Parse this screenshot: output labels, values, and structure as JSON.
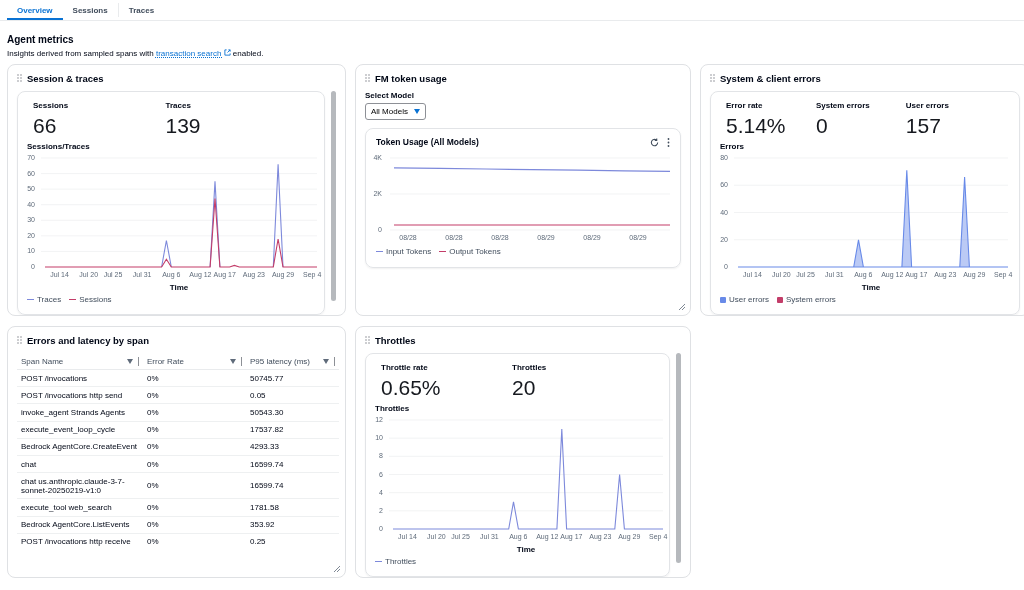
{
  "tabs": [
    {
      "label": "Overview",
      "selected": true
    },
    {
      "label": "Sessions",
      "selected": false
    },
    {
      "label": "Traces",
      "selected": false
    }
  ],
  "heading": "Agent metrics",
  "description": {
    "before": "Insights derived from sampled spans with",
    "link": "transaction search",
    "after": "enabled."
  },
  "panels": [
    {
      "kind": "metrics",
      "title": "Session & traces",
      "scrollable": true,
      "stats": [
        {
          "label": "Sessions",
          "value": "66"
        },
        {
          "label": "Traces",
          "value": "139"
        }
      ],
      "chart_data": {
        "type": "line",
        "ylabel": "Sessions/Traces",
        "xlabel": "Time",
        "ylim": [
          0,
          70
        ],
        "yticks": [
          0,
          10,
          20,
          30,
          40,
          50,
          60,
          70
        ],
        "categories": [
          null,
          null,
          null,
          "Jul 14",
          null,
          null,
          null,
          null,
          null,
          "Jul 20",
          null,
          null,
          null,
          null,
          "Jul 25",
          null,
          null,
          null,
          null,
          null,
          "Jul 31",
          null,
          null,
          null,
          null,
          null,
          "Aug 6",
          null,
          null,
          null,
          null,
          null,
          "Aug 12",
          null,
          null,
          null,
          null,
          "Aug 17",
          null,
          null,
          null,
          null,
          null,
          "Aug 23",
          null,
          null,
          null,
          null,
          null,
          "Aug 29",
          null,
          null,
          null,
          null,
          null,
          "Sep 4",
          null
        ],
        "grid": true,
        "series": [
          {
            "name": "Traces",
            "color": "#7d89db",
            "values": [
              null,
              null,
              null,
              null,
              null,
              null,
              null,
              null,
              null,
              null,
              null,
              null,
              null,
              null,
              null,
              null,
              null,
              null,
              null,
              null,
              null,
              null,
              null,
              null,
              0,
              17,
              0,
              null,
              null,
              null,
              null,
              null,
              null,
              null,
              0,
              55,
              0,
              null,
              null,
              null,
              null,
              null,
              null,
              null,
              null,
              null,
              null,
              0,
              66,
              0,
              null,
              null,
              null,
              null,
              null,
              null,
              null
            ]
          },
          {
            "name": "Sessions",
            "color": "#c33d69",
            "values": [
              0,
              0,
              0,
              0,
              0,
              0,
              0,
              0,
              0,
              0,
              0,
              0,
              0,
              0,
              0,
              0,
              0,
              0,
              0,
              0,
              0,
              0,
              0,
              0,
              0,
              5,
              0,
              0,
              0,
              0,
              0,
              0,
              0,
              0,
              0,
              44,
              0,
              0,
              0,
              1,
              0,
              0,
              0,
              0,
              0,
              0,
              0,
              0,
              18,
              0,
              0,
              0,
              0,
              0,
              0,
              0,
              0
            ]
          }
        ]
      }
    },
    {
      "kind": "token",
      "title": "FM token usage",
      "select": {
        "label": "Select Model",
        "value": "All Models"
      },
      "inner_title": "Token Usage (All Models)",
      "chart_data": {
        "type": "line",
        "ylim": [
          0,
          4000
        ],
        "grid": true,
        "yticks": [
          {
            "value": 0,
            "label": "0"
          },
          {
            "value": 2000,
            "label": "2K"
          },
          {
            "value": 4000,
            "label": "4K"
          }
        ],
        "categories": [
          "08/28",
          "08/28",
          "08/28",
          "08/29",
          "08/29",
          "08/29",
          null
        ],
        "series": [
          {
            "name": "Input Tokens",
            "color": "#7d89db",
            "values": [
              3450,
              3420,
              3390,
              3350,
              3320,
              3290,
              3260
            ]
          },
          {
            "name": "Output Tokens",
            "color": "#c33d69",
            "values": [
              280,
              280,
              280,
              280,
              280,
              280,
              280
            ]
          }
        ]
      }
    },
    {
      "kind": "metrics",
      "title": "System & client errors",
      "stats": [
        {
          "label": "Error rate",
          "value": "5.14%"
        },
        {
          "label": "System errors",
          "value": "0"
        },
        {
          "label": "User errors",
          "value": "157"
        }
      ],
      "chart_data": {
        "type": "area",
        "ylabel": "Errors",
        "xlabel": "Time",
        "ylim": [
          0,
          80
        ],
        "yticks": [
          0,
          20,
          40,
          60,
          80
        ],
        "grid": true,
        "categories": [
          null,
          null,
          null,
          "Jul 14",
          null,
          null,
          null,
          null,
          null,
          "Jul 20",
          null,
          null,
          null,
          null,
          "Jul 25",
          null,
          null,
          null,
          null,
          null,
          "Jul 31",
          null,
          null,
          null,
          null,
          null,
          "Aug 6",
          null,
          null,
          null,
          null,
          null,
          "Aug 12",
          null,
          null,
          null,
          null,
          "Aug 17",
          null,
          null,
          null,
          null,
          null,
          "Aug 23",
          null,
          null,
          null,
          null,
          null,
          "Aug 29",
          null,
          null,
          null,
          null,
          null,
          "Sep 4",
          null
        ],
        "series": [
          {
            "name": "User errors",
            "color": "#688ae8",
            "values": [
              0,
              0,
              0,
              0,
              0,
              0,
              0,
              0,
              0,
              0,
              0,
              0,
              0,
              0,
              0,
              0,
              0,
              0,
              0,
              0,
              0,
              0,
              0,
              0,
              0,
              20,
              0,
              0,
              0,
              0,
              0,
              0,
              0,
              0,
              0,
              71,
              0,
              0,
              0,
              0,
              0,
              0,
              0,
              0,
              0,
              0,
              0,
              66,
              0,
              0,
              0,
              0,
              0,
              0,
              0,
              0,
              0
            ]
          },
          {
            "name": "System errors",
            "color": "#c33d69",
            "values": [
              null,
              null,
              null,
              null,
              null,
              null,
              null,
              null,
              null,
              null,
              null,
              null,
              null,
              null,
              null,
              null,
              null,
              null,
              null,
              null,
              null,
              null,
              null,
              null,
              null,
              null,
              null,
              null,
              null,
              null,
              null,
              null,
              null,
              null,
              null,
              null,
              null,
              null,
              null,
              null,
              null,
              null,
              null,
              null,
              null,
              null,
              null,
              null,
              null,
              null,
              null,
              null,
              null,
              null,
              null,
              null,
              null
            ]
          }
        ]
      }
    },
    {
      "kind": "table",
      "title": "Errors and latency by span",
      "columns": [
        "Span Name",
        "Error Rate",
        "P95 latency (ms)"
      ],
      "rows": [
        [
          "POST /invocations",
          "0%",
          "50745.77"
        ],
        [
          "POST /invocations http send",
          "0%",
          "0.05"
        ],
        [
          "invoke_agent Strands Agents",
          "0%",
          "50543.30"
        ],
        [
          "execute_event_loop_cycle",
          "0%",
          "17537.82"
        ],
        [
          "Bedrock AgentCore.CreateEvent",
          "0%",
          "4293.33"
        ],
        [
          "chat",
          "0%",
          "16599.74"
        ],
        [
          "chat us.anthropic.claude-3-7-sonnet-20250219-v1:0",
          "0%",
          "16599.74"
        ],
        [
          "execute_tool web_search",
          "0%",
          "1781.58"
        ],
        [
          "Bedrock AgentCore.ListEvents",
          "0%",
          "353.92"
        ],
        [
          "POST /invocations http receive",
          "0%",
          "0.25"
        ]
      ]
    },
    {
      "kind": "metrics",
      "title": "Throttles",
      "scrollable": true,
      "stats": [
        {
          "label": "Throttle rate",
          "value": "0.65%"
        },
        {
          "label": "Throttles",
          "value": "20"
        }
      ],
      "chart_data": {
        "type": "line",
        "ylabel": "Throttles",
        "xlabel": "Time",
        "ylim": [
          0,
          12
        ],
        "yticks": [
          0,
          2,
          4,
          6,
          8,
          10,
          12
        ],
        "grid": true,
        "categories": [
          null,
          null,
          null,
          "Jul 14",
          null,
          null,
          null,
          null,
          null,
          "Jul 20",
          null,
          null,
          null,
          null,
          "Jul 25",
          null,
          null,
          null,
          null,
          null,
          "Jul 31",
          null,
          null,
          null,
          null,
          null,
          "Aug 6",
          null,
          null,
          null,
          null,
          null,
          "Aug 12",
          null,
          null,
          null,
          null,
          "Aug 17",
          null,
          null,
          null,
          null,
          null,
          "Aug 23",
          null,
          null,
          null,
          null,
          null,
          "Aug 29",
          null,
          null,
          null,
          null,
          null,
          "Sep 4",
          null
        ],
        "series": [
          {
            "name": "Throttles",
            "color": "#7d89db",
            "values": [
              0,
              0,
              0,
              0,
              0,
              0,
              0,
              0,
              0,
              0,
              0,
              0,
              0,
              0,
              0,
              0,
              0,
              0,
              0,
              0,
              0,
              0,
              0,
              0,
              0,
              3,
              0,
              0,
              0,
              0,
              0,
              0,
              0,
              0,
              0,
              11,
              0,
              0,
              0,
              0,
              0,
              0,
              0,
              0,
              0,
              0,
              0,
              6,
              0,
              0,
              0,
              0,
              0,
              0,
              0,
              0,
              0
            ]
          }
        ]
      }
    }
  ]
}
